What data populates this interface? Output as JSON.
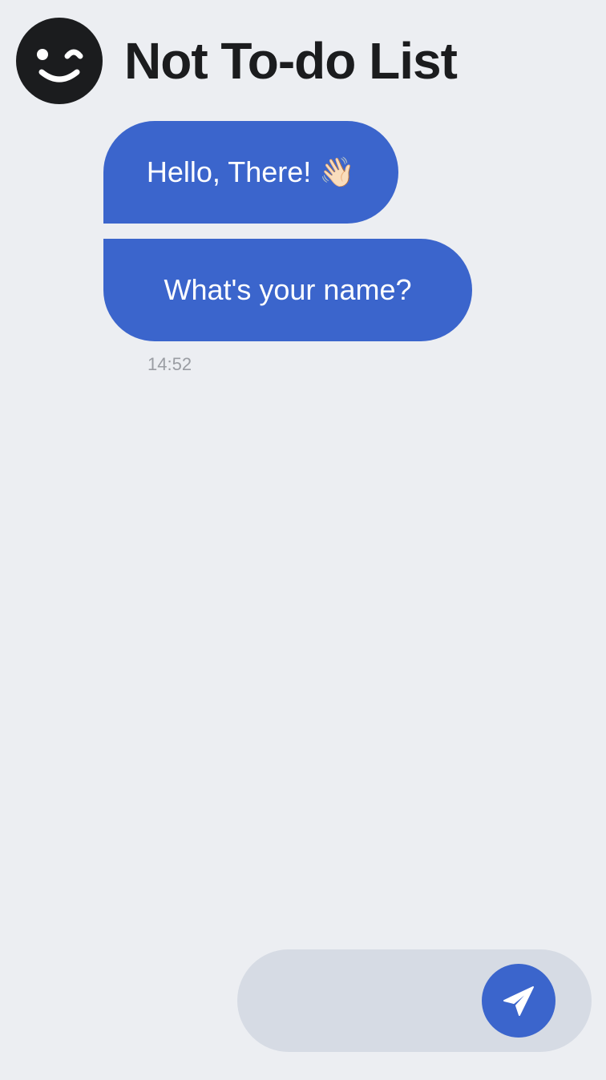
{
  "header": {
    "title": "Not To-do List",
    "avatar_icon": "wink-face-icon"
  },
  "messages": [
    {
      "text": "Hello, There! 👋🏻"
    },
    {
      "text": "What's your name?"
    }
  ],
  "timestamp": "14:52",
  "composer": {
    "input_value": "",
    "send_icon": "paper-plane-icon"
  },
  "colors": {
    "background": "#ECEEF2",
    "accent": "#3B65CC",
    "title": "#1B1C1E",
    "composer": "#D6DBE4",
    "timestamp": "#9A9DA3"
  }
}
